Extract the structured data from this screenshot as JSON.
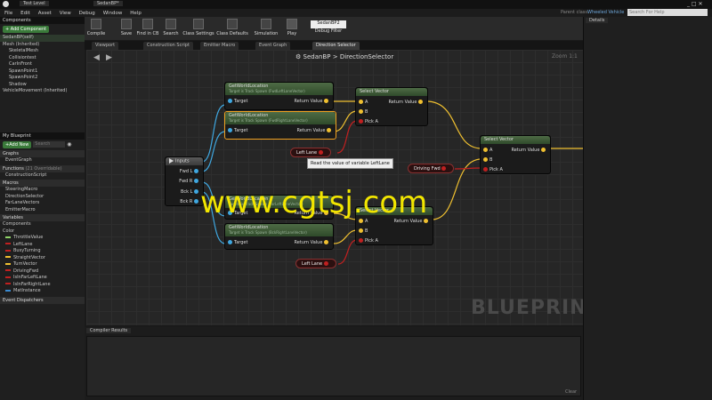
{
  "window": {
    "tab1": "Test Level",
    "tab2": "SedanBP*",
    "parent_class_label": "Parent class:",
    "parent_class": "Wheeled Vehicle",
    "help_search": "Search For Help"
  },
  "menu": [
    "File",
    "Edit",
    "Asset",
    "View",
    "Debug",
    "Window",
    "Help"
  ],
  "toolbar": {
    "compile": "Compile",
    "save": "Save",
    "find_in_cb": "Find in CB",
    "search": "Search",
    "class_settings": "Class Settings",
    "class_defaults": "Class Defaults",
    "simulation": "Simulation",
    "play": "Play",
    "debug_value": "SedanBP2",
    "debug_filter": "Debug Filter"
  },
  "tabs": [
    "Viewport",
    "Construction Script",
    "Emitter Macro",
    "Event Graph",
    "Direction Selector"
  ],
  "breadcrumb": {
    "root": "SedanBP",
    "sep": ">",
    "current": "DirectionSelector",
    "zoom": "Zoom 1:1"
  },
  "components": {
    "header": "Components",
    "add": "+ Add Component",
    "self": "SedanBP(self)",
    "items": [
      "Mesh (Inherited)",
      "SkeletalMesh",
      "Collisiontest",
      "CarInFront",
      "SpawnPoint1",
      "SpawnPoint2",
      "Shadow",
      "VehicleMovement (Inherited)"
    ]
  },
  "mybp": {
    "header": "My Blueprint",
    "add_new": "+Add New",
    "search": "Search",
    "graphs": "Graphs",
    "event_graph": "EventGraph",
    "functions": "Functions",
    "functions_count": "(21 Overridable)",
    "construction": "ConstructionScript",
    "macros": "Macros",
    "macro_items": [
      "SteeringMacro",
      "DirectionSelector",
      "FarLaneVectors",
      "EmitterMacro"
    ],
    "variables": "Variables",
    "comp": "Components",
    "color": "Color",
    "var_items": [
      {
        "name": "ThrottleValue",
        "color": "#8fd468"
      },
      {
        "name": "LeftLane",
        "color": "#c02020"
      },
      {
        "name": "BusyTurning",
        "color": "#c02020"
      },
      {
        "name": "StraightVector",
        "color": "#f0c030"
      },
      {
        "name": "TurnVector",
        "color": "#f0c030"
      },
      {
        "name": "DrivingFwd",
        "color": "#c02020"
      },
      {
        "name": "IsInFarLeftLane",
        "color": "#c02020"
      },
      {
        "name": "IsInFarRightLane",
        "color": "#c02020"
      },
      {
        "name": "MatInstance",
        "color": "#3a8ad0"
      }
    ],
    "dispatchers": "Event Dispatchers"
  },
  "nodes": {
    "gwl1": {
      "title": "GetWorldLocation",
      "sub": "Target is Track Spawn (FwdLeftLaneVector)",
      "target": "Target",
      "ret": "Return Value"
    },
    "gwl2": {
      "title": "GetWorldLocation",
      "sub": "Target is Track Spawn (FwdRightLaneVector)",
      "target": "Target",
      "ret": "Return Value"
    },
    "gwl3": {
      "title": "GetWorldLocation",
      "sub": "Target is Track Spawn (FarLeftLaneVector)",
      "target": "Target",
      "ret": "Return Value"
    },
    "gwl4": {
      "title": "GetWorldLocation",
      "sub": "Target is Track Spawn (BckRightLaneVector)",
      "target": "Target",
      "ret": "Return Value"
    },
    "sel1": {
      "title": "Select Vector",
      "a": "A",
      "b": "B",
      "pick": "Pick A",
      "ret": "Return Value"
    },
    "sel2": {
      "title": "Select Vector",
      "a": "A",
      "b": "B",
      "pick": "Pick A",
      "ret": "Return Value"
    },
    "sel3": {
      "title": "Select Vector",
      "a": "A",
      "b": "B",
      "pick": "Pick A",
      "ret": "Return Value"
    },
    "inputs": {
      "title": "Inputs",
      "p1": "Fwd L",
      "p2": "Fwd R",
      "p3": "Bck L",
      "p4": "Bck R"
    },
    "var_leftlane": "Left Lane",
    "var_leftlane2": "Left Lane",
    "var_drivingfwd": "Driving Fwd",
    "tooltip": "Read the value of variable LeftLane"
  },
  "blueprint_mark": "BLUEPRINT",
  "compiler": {
    "tab": "Compiler Results",
    "clear": "Clear"
  },
  "details": {
    "tab": "Details"
  },
  "watermark": "www.cgtsj.com"
}
